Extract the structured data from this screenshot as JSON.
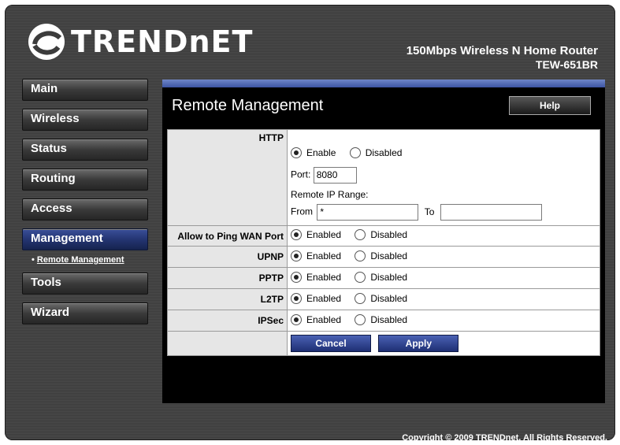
{
  "brand": {
    "logo": "TRENDnET",
    "product_line1": "150Mbps Wireless N Home Router",
    "product_line2": "TEW-651BR"
  },
  "nav": {
    "items": [
      "Main",
      "Wireless",
      "Status",
      "Routing",
      "Access",
      "Management",
      "Tools",
      "Wizard"
    ],
    "active": "Management",
    "sub_item": "Remote Management"
  },
  "page": {
    "title": "Remote Management",
    "help": "Help"
  },
  "form": {
    "http": {
      "label": "HTTP",
      "enable": "Enable",
      "disabled": "Disabled",
      "port_label": "Port:",
      "port_value": "8080",
      "range_label": "Remote IP Range:",
      "from_label": "From",
      "from_value": "*",
      "to_label": "To",
      "to_value": ""
    },
    "ping": {
      "label": "Allow to Ping WAN Port",
      "enabled": "Enabled",
      "disabled": "Disabled"
    },
    "upnp": {
      "label": "UPNP",
      "enabled": "Enabled",
      "disabled": "Disabled"
    },
    "pptp": {
      "label": "PPTP",
      "enabled": "Enabled",
      "disabled": "Disabled"
    },
    "l2tp": {
      "label": "L2TP",
      "enabled": "Enabled",
      "disabled": "Disabled"
    },
    "ipsec": {
      "label": "IPSec",
      "enabled": "Enabled",
      "disabled": "Disabled"
    },
    "cancel": "Cancel",
    "apply": "Apply"
  },
  "footer": {
    "copyright": "Copyright © 2009 TRENDnet. All Rights Reserved."
  }
}
